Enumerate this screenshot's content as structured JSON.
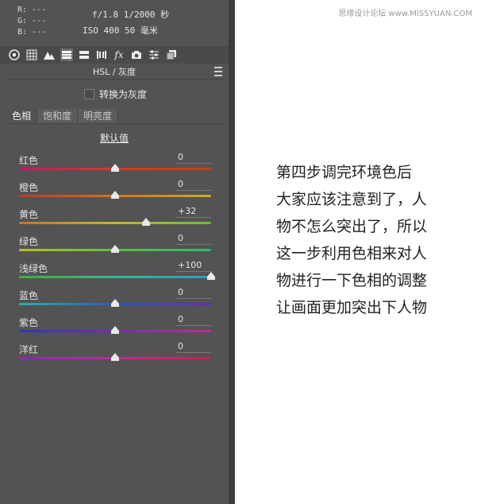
{
  "info": {
    "r": "R: ---",
    "g": "G: ---",
    "b": "B: ---",
    "exif_line1": "f/1.8  1/2000 秒",
    "exif_line2": "ISO 400   50 毫米"
  },
  "toolbar": {
    "icons": [
      "aperture-icon",
      "grid-icon",
      "mountain-icon",
      "hsl-icon",
      "split-tone-icon",
      "lens-icon",
      "fx-icon",
      "camera-icon",
      "sliders-icon",
      "presets-icon"
    ]
  },
  "panel": {
    "title": "HSL / 灰度",
    "convert_gray": "转换为灰度",
    "tabs": [
      "色相",
      "饱和度",
      "明亮度"
    ],
    "default_label": "默认值"
  },
  "sliders": [
    {
      "label": "红色",
      "value": "0",
      "pos": 0.5,
      "colors": [
        "#c01a6a",
        "#d43a2a",
        "#c04020"
      ]
    },
    {
      "label": "橙色",
      "value": "0",
      "pos": 0.5,
      "colors": [
        "#c03a2a",
        "#d8701c",
        "#c8b020"
      ]
    },
    {
      "label": "黄色",
      "value": "+32",
      "pos": 0.66,
      "colors": [
        "#d07020",
        "#c8b820",
        "#6cc030"
      ]
    },
    {
      "label": "绿色",
      "value": "0",
      "pos": 0.5,
      "colors": [
        "#b8c020",
        "#5cc040",
        "#2cb870"
      ]
    },
    {
      "label": "浅绿色",
      "value": "+100",
      "pos": 1.0,
      "colors": [
        "#40b040",
        "#30b890",
        "#2ca0c0"
      ]
    },
    {
      "label": "蓝色",
      "value": "0",
      "pos": 0.5,
      "colors": [
        "#28b0b0",
        "#2a5cc0",
        "#6a2ab0"
      ]
    },
    {
      "label": "紫色",
      "value": "0",
      "pos": 0.5,
      "colors": [
        "#2a3ab8",
        "#7a2ab8",
        "#c02aa0"
      ]
    },
    {
      "label": "洋红",
      "value": "0",
      "pos": 0.5,
      "colors": [
        "#8a2ab8",
        "#c02aa0",
        "#c82050"
      ]
    }
  ],
  "right": {
    "watermark": "思缘设计论坛 www.MISSYUAN.COM",
    "lines": [
      "第四步调完环境色后",
      "大家应该注意到了，人",
      "物不怎么突出了，所以",
      "这一步利用色相来对人",
      "物进行一下色相的调整",
      "让画面更加突出下人物"
    ]
  }
}
